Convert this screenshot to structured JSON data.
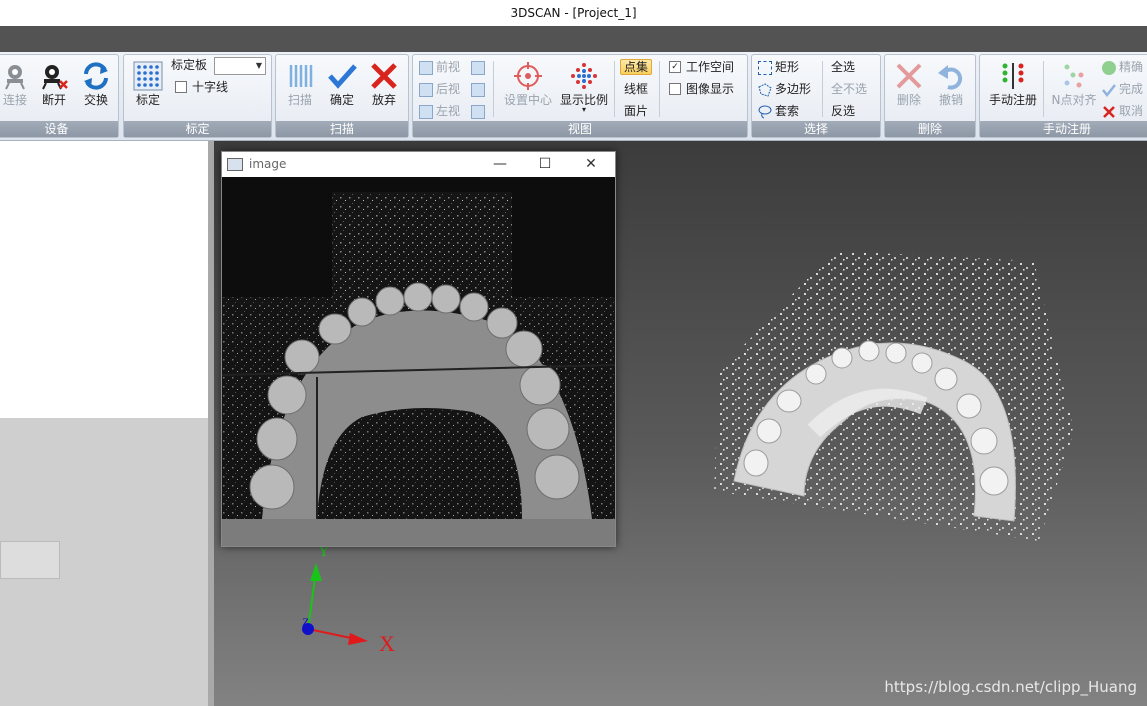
{
  "window": {
    "title": "3DSCAN - [Project_1]"
  },
  "ribbon": {
    "device": {
      "label": "设备",
      "connect": "连接",
      "disconnect": "断开",
      "switch": "交换"
    },
    "calib": {
      "label": "标定",
      "calibrate": "标定",
      "board_label": "标定板",
      "board_value": "",
      "crosshair": "十字线"
    },
    "scan": {
      "label": "扫描",
      "scan": "扫描",
      "confirm": "确定",
      "discard": "放弃"
    },
    "view": {
      "label": "视图",
      "front": "前视",
      "back": "后视",
      "left": "左视",
      "set_center": "设置中心",
      "display_ratio": "显示比例",
      "point_cloud": "点集",
      "wireframe": "线框",
      "surface": "面片",
      "workspace": "工作空间",
      "workspace_checked": true,
      "image_display": "图像显示",
      "image_display_checked": false
    },
    "select": {
      "label": "选择",
      "rect": "矩形",
      "polygon": "多边形",
      "lasso": "套索",
      "all": "全选",
      "none": "全不选",
      "invert": "反选"
    },
    "delete": {
      "label": "删除",
      "delete": "删除",
      "undo": "撤销"
    },
    "manual_reg": {
      "label": "手动注册",
      "manual": "手动注册",
      "n_point": "N点对齐",
      "precise": "精确",
      "done": "完成",
      "cancel": "取消"
    }
  },
  "image_window": {
    "title": "image"
  },
  "axes": {
    "x": "X",
    "y": "Y",
    "z": "Z"
  },
  "watermark": "https://blog.csdn.net/clipp_Huang",
  "colors": {
    "accent_red": "#d9231d",
    "accent_blue": "#1f6fc2",
    "x_axis": "#e01a1a",
    "y_axis": "#19c419",
    "z_axis": "#1010c8"
  }
}
